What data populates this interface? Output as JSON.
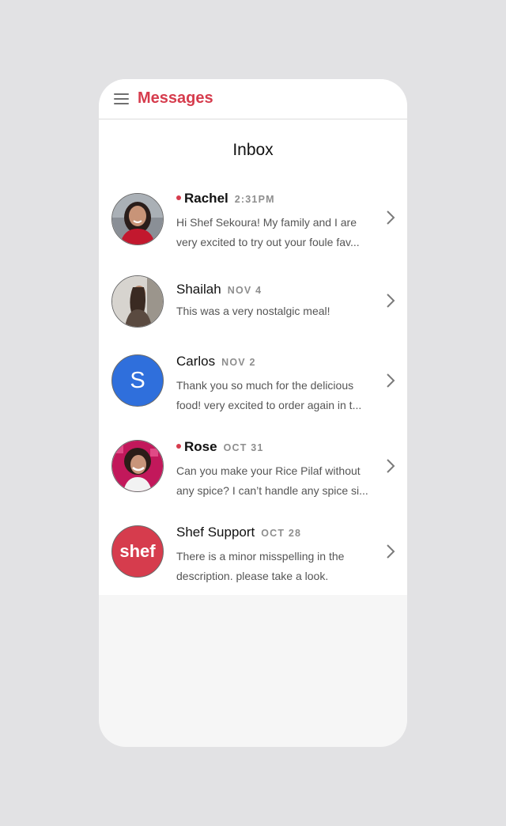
{
  "header": {
    "title": "Messages"
  },
  "inbox": {
    "title": "Inbox"
  },
  "conversations": [
    {
      "name": "Rachel",
      "date": "2:31PM",
      "unread": true,
      "avatar": "photo-rachel",
      "preview_line1": "Hi Shef Sekoura! My family and I are",
      "preview_line2": "very excited to try out your foule fav..."
    },
    {
      "name": "Shailah",
      "date": "NOV 4",
      "unread": false,
      "avatar": "photo-shailah",
      "preview_line1": "This was a very nostalgic meal!",
      "preview_line2": ""
    },
    {
      "name": "Carlos",
      "date": "NOV 2",
      "unread": false,
      "avatar_letter": "S",
      "preview_line1": "Thank you so much for the delicious",
      "preview_line2": "food! very excited to order again in t..."
    },
    {
      "name": "Rose",
      "date": "OCT 31",
      "unread": true,
      "avatar": "photo-rose",
      "preview_line1": "Can you make your Rice Pilaf without",
      "preview_line2": "any spice? I can’t handle any spice si..."
    },
    {
      "name": "Shef Support",
      "date": "OCT 28",
      "unread": false,
      "avatar_logo_text": "shef",
      "preview_line1": "There is a minor misspelling in the",
      "preview_line2": "description. please take a look."
    }
  ],
  "colors": {
    "accent": "#d63c4d",
    "letter_avatar": "#2f6fdc",
    "background": "#e2e2e4"
  }
}
